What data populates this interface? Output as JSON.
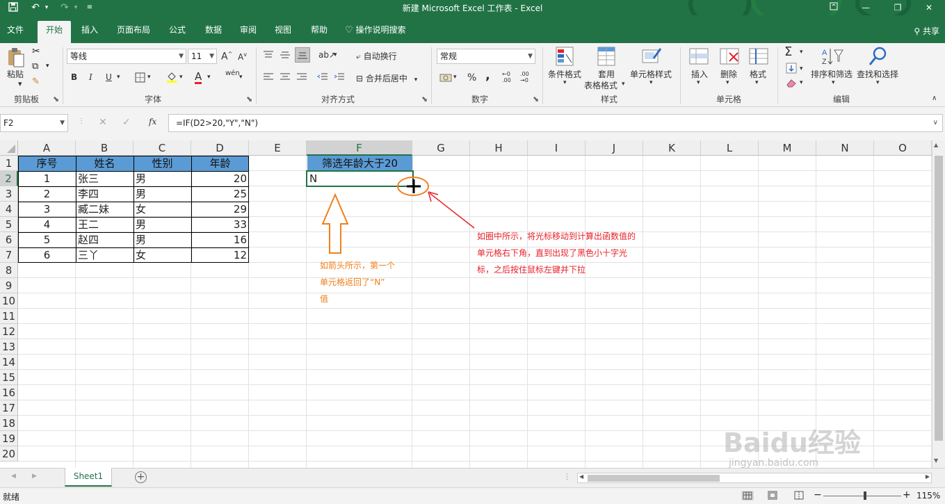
{
  "titlebar": {
    "title": "新建 Microsoft Excel 工作表  -  Excel",
    "save_icon": "save-icon",
    "undo_icon": "undo-icon",
    "redo_icon": "redo-icon",
    "customize_icon": "customize-quick-access-icon",
    "ribbon_display_icon": "ribbon-display-options-icon"
  },
  "menu": {
    "tabs": [
      "文件",
      "开始",
      "插入",
      "页面布局",
      "公式",
      "数据",
      "审阅",
      "视图",
      "帮助"
    ],
    "active_index": 1,
    "tell_me": "操作说明搜索",
    "share": "共享"
  },
  "ribbon": {
    "clipboard": {
      "label": "剪贴板",
      "paste": "粘贴"
    },
    "font": {
      "label": "字体",
      "font_name": "等线",
      "font_size": "11",
      "bold": "B",
      "italic": "I",
      "underline": "U",
      "font_color_glyph": "A",
      "wen": "wén"
    },
    "alignment": {
      "label": "对齐方式",
      "wrap": "自动换行",
      "merge": "合并后居中"
    },
    "number": {
      "label": "数字",
      "format": "常规",
      "percent": "%",
      "comma": ",",
      "inc_dec": ".00",
      "dec_dec": ".00"
    },
    "styles": {
      "label": "样式",
      "conditional": "条件格式",
      "table_line1": "套用",
      "table_line2": "表格格式",
      "cell_style": "单元格样式"
    },
    "cells": {
      "label": "单元格",
      "insert": "插入",
      "delete": "删除",
      "format": "格式"
    },
    "editing": {
      "label": "编辑",
      "sort": "排序和筛选",
      "find": "查找和选择",
      "sum": "Σ"
    }
  },
  "formula_bar": {
    "name_box": "F2",
    "cancel": "✕",
    "enter": "✓",
    "fx": "fx",
    "formula": "=IF(D2>20,\"Y\",\"N\")"
  },
  "columns": [
    "A",
    "B",
    "C",
    "D",
    "E",
    "F",
    "G",
    "H",
    "I",
    "J",
    "K",
    "L",
    "M",
    "N",
    "O"
  ],
  "rows": [
    "1",
    "2",
    "3",
    "4",
    "5",
    "6",
    "7",
    "8",
    "9",
    "10",
    "11",
    "12",
    "13",
    "14",
    "15",
    "16",
    "17",
    "18",
    "19",
    "20"
  ],
  "table": {
    "headers": [
      "序号",
      "姓名",
      "性别",
      "年龄"
    ],
    "rows": [
      [
        "1",
        "张三",
        "男",
        "20"
      ],
      [
        "2",
        "李四",
        "男",
        "25"
      ],
      [
        "3",
        "臧二妹",
        "女",
        "29"
      ],
      [
        "4",
        "王二",
        "男",
        "33"
      ],
      [
        "5",
        "赵四",
        "男",
        "16"
      ],
      [
        "6",
        "三丫",
        "女",
        "12"
      ]
    ]
  },
  "filter_cell": {
    "header": "筛选年龄大于20",
    "result": "N"
  },
  "annotations": {
    "orange_lines": [
      "如箭头所示，第一个",
      "单元格返回了“N”",
      "值"
    ],
    "red_lines": [
      "如圈中所示，将光标移动到计算出函数值的",
      "单元格右下角，直到出现了黑色小十字光",
      "标，之后按住鼠标左键并下拉"
    ],
    "orange_color": "#f07f1b",
    "red_color": "#e8202a"
  },
  "sheets": {
    "tab": "Sheet1",
    "add": "+"
  },
  "status": {
    "ready": "就绪",
    "zoom": "115%",
    "minus": "−",
    "plus": "+"
  },
  "watermark": {
    "text": "Baidu经验",
    "url": "jingyan.baidu.com"
  },
  "colors": {
    "excel_green": "#217346",
    "table_header_blue": "#5b9bd5"
  }
}
